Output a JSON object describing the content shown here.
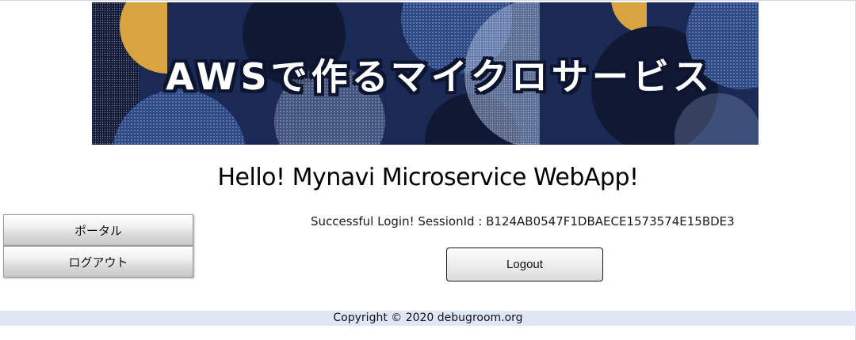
{
  "banner": {
    "title": "AWSで作るマイクロサービス",
    "colors": {
      "navy": "#1b2a55",
      "dark": "#111833",
      "blue": "#2d4a86",
      "gold": "#d9a440",
      "light": "#8ea3c9"
    }
  },
  "heading": "Hello! Mynavi Microservice WebApp!",
  "menu": {
    "items": [
      {
        "label": "ポータル"
      },
      {
        "label": "ログアウト"
      }
    ]
  },
  "session": {
    "message": "Successful Login! SessionId : B124AB0547F1DBAECE1573574E15BDE3"
  },
  "logout_button": {
    "label": "Logout"
  },
  "footer": {
    "copyright": "Copyright © 2020 debugroom.org"
  },
  "colors": {
    "footer_bg": "#dfe7f6"
  }
}
